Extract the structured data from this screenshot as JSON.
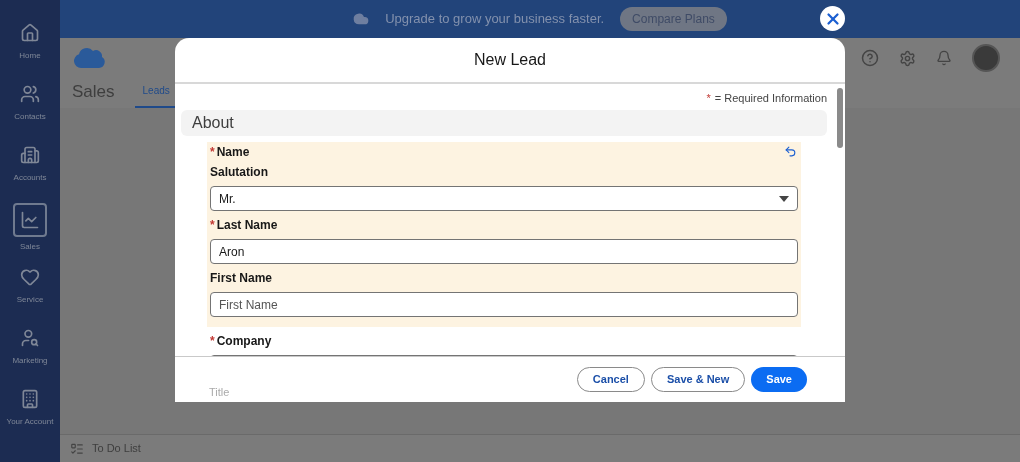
{
  "banner": {
    "text": "Upgrade to grow your business faster.",
    "button": "Compare Plans"
  },
  "sidebar": {
    "items": [
      {
        "label": "Home",
        "selected": false
      },
      {
        "label": "Contacts",
        "selected": false
      },
      {
        "label": "Accounts",
        "selected": false
      },
      {
        "label": "Sales",
        "selected": true
      },
      {
        "label": "Service",
        "selected": false
      },
      {
        "label": "Marketing",
        "selected": false
      },
      {
        "label": "Your Account",
        "selected": false
      }
    ]
  },
  "app": {
    "title": "Sales",
    "tabs": [
      {
        "label": "Leads",
        "selected": true
      }
    ]
  },
  "bottom_bar": {
    "label": "To Do List"
  },
  "modal": {
    "title": "New Lead",
    "required_note": "= Required Information",
    "required_mark": "*",
    "section": "About",
    "name_group": {
      "label": "Name",
      "required": true,
      "edited": true,
      "fields": [
        {
          "kind": "select",
          "label": "Salutation",
          "required": false,
          "value": "Mr."
        },
        {
          "kind": "text",
          "label": "Last Name",
          "required": true,
          "value": "Aron"
        },
        {
          "kind": "text",
          "label": "First Name",
          "required": false,
          "placeholder": "First Name"
        }
      ]
    },
    "fields": [
      {
        "kind": "text",
        "label": "Company",
        "required": true
      }
    ],
    "hidden_label": "Title",
    "buttons": [
      {
        "label": "Cancel",
        "primary": false
      },
      {
        "label": "Save & New",
        "primary": false
      },
      {
        "label": "Save",
        "primary": true
      }
    ]
  }
}
